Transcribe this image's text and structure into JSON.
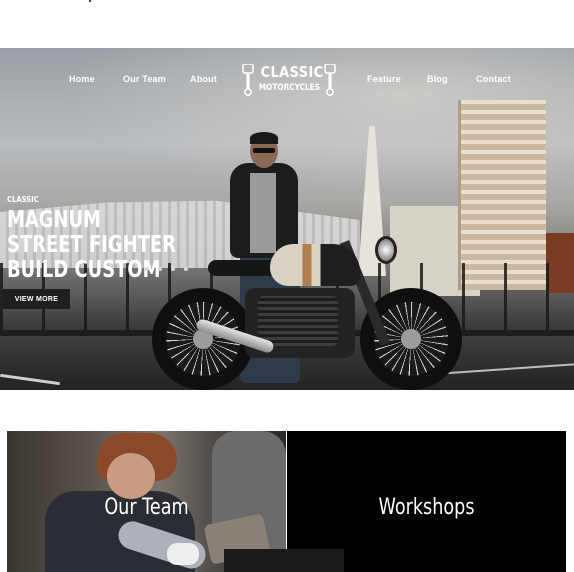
{
  "nav": {
    "items": [
      {
        "label": "Home"
      },
      {
        "label": "Our Team"
      },
      {
        "label": "About"
      },
      {
        "label": "Feature"
      },
      {
        "label": "Blog"
      },
      {
        "label": "Contact"
      }
    ],
    "logo": {
      "line1": "CLASSIC",
      "line2": "MOTORCYCLES",
      "icon": "piston-icon"
    }
  },
  "hero": {
    "kicker": "CLASSIC",
    "lines": [
      "MAGNUM",
      "STREET FIGHTER",
      "BUILD CUSTOM"
    ],
    "button_label": "VIEW MORE",
    "slides": 4
  },
  "tiles": [
    {
      "title": "Our Team"
    },
    {
      "title": "Workshops"
    }
  ],
  "colors": {
    "button_bg": "#1f1f1f",
    "workshops_bg": "#000000",
    "text": "#ffffff"
  }
}
